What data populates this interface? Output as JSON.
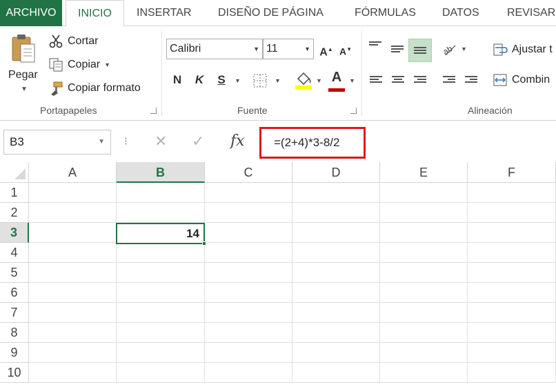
{
  "tabs": [
    {
      "label": "ARCHIVO"
    },
    {
      "label": "INICIO"
    },
    {
      "label": "INSERTAR"
    },
    {
      "label": "DISEÑO DE PÁGINA"
    },
    {
      "label": "FÓRMULAS"
    },
    {
      "label": "DATOS"
    },
    {
      "label": "REVISAR"
    }
  ],
  "ribbon": {
    "clipboard": {
      "paste_label": "Pegar",
      "cut_label": "Cortar",
      "copy_label": "Copiar",
      "format_painter_label": "Copiar formato",
      "group_label": "Portapapeles"
    },
    "font": {
      "font_name": "Calibri",
      "font_size": "11",
      "grow_label": "A",
      "shrink_label": "A",
      "bold_label": "N",
      "italic_label": "K",
      "underline_label": "S",
      "font_color_label": "A",
      "group_label": "Fuente"
    },
    "alignment": {
      "wrap_label": "Ajustar t",
      "merge_label": "Combin",
      "group_label": "Alineación"
    }
  },
  "formula_bar": {
    "name_box": "B3",
    "fx_label": "fx",
    "formula": "=(2+4)*3-8/2"
  },
  "grid": {
    "columns": [
      "A",
      "B",
      "C",
      "D",
      "E",
      "F"
    ],
    "rows": [
      "1",
      "2",
      "3",
      "4",
      "5",
      "6",
      "7",
      "8",
      "9",
      "10"
    ],
    "selected_column": "B",
    "selected_row": "3",
    "active_cell_value": "14"
  },
  "colors": {
    "accent": "#217346",
    "highlight_box": "#e0161b",
    "font_color_bar": "#c00000",
    "fill_color_bar": "#ffff00"
  },
  "icons": [
    "paste-icon",
    "scissors-icon",
    "copy-icon",
    "format-painter-icon",
    "borders-icon",
    "fill-color-icon",
    "cancel-icon",
    "enter-icon",
    "fx-icon"
  ]
}
